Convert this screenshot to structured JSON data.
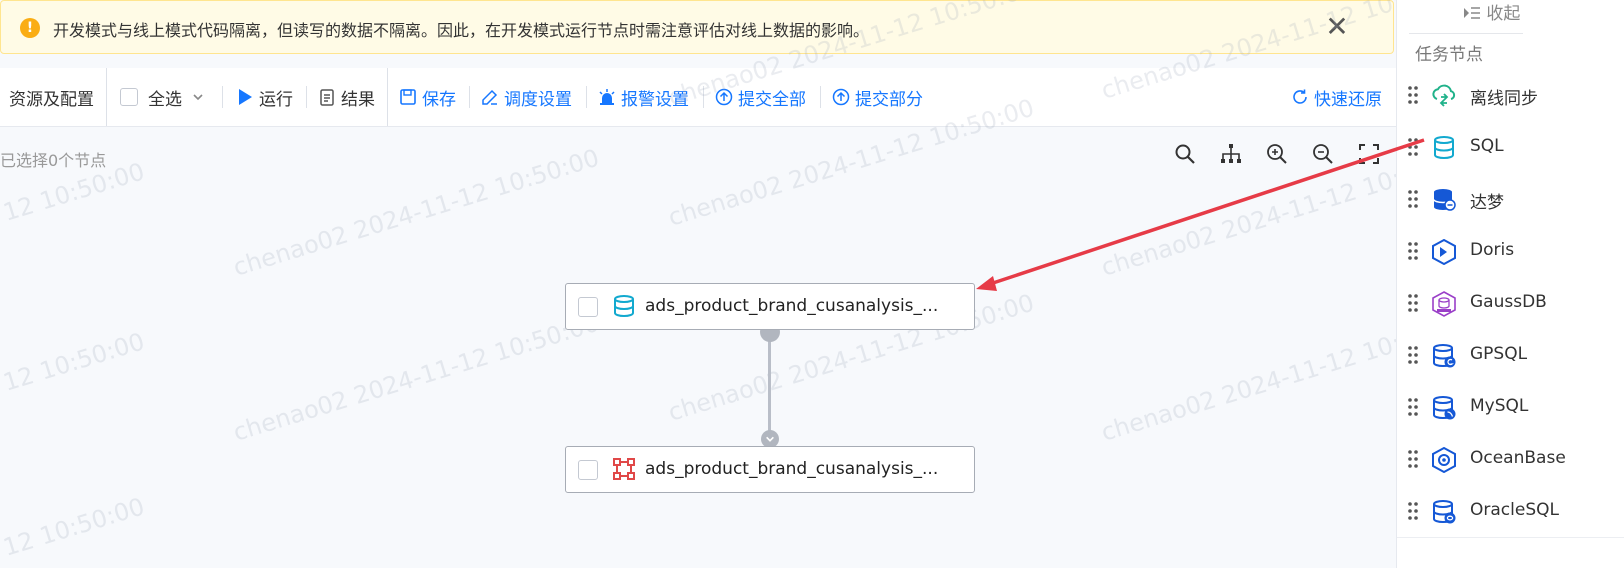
{
  "banner": {
    "text": "开发模式与线上模式代码隔离，但读写的数据不隔离。因此，在开发模式运行节点时需注意评估对线上数据的影响。",
    "icon": "warning-icon",
    "close_icon": "close-icon"
  },
  "toolbar": {
    "resources": "资源及配置",
    "select_all": "全选",
    "run": "运行",
    "result": "结果",
    "save": "保存",
    "schedule": "调度设置",
    "alarm": "报警设置",
    "submit_all": "提交全部",
    "submit_part": "提交部分",
    "quick_restore": "快速还原"
  },
  "canvas": {
    "selected_text": "已选择0个节点",
    "nodes": [
      {
        "label": "ads_product_brand_cusanalysis_...",
        "icon": "database-icon"
      },
      {
        "label": "ads_product_brand_cusanalysis_...",
        "icon": "node-frame-icon"
      }
    ]
  },
  "sidebar": {
    "collapse": "收起",
    "title": "任务节点",
    "items": [
      {
        "label": "离线同步",
        "icon": "cloud-sync-icon"
      },
      {
        "label": "SQL",
        "icon": "sql-db-icon"
      },
      {
        "label": "达梦",
        "icon": "dameng-db-icon"
      },
      {
        "label": "Doris",
        "icon": "doris-icon"
      },
      {
        "label": "GaussDB",
        "icon": "gaussdb-icon"
      },
      {
        "label": "GPSQL",
        "icon": "gpsql-icon"
      },
      {
        "label": "MySQL",
        "icon": "mysql-icon"
      },
      {
        "label": "OceanBase",
        "icon": "oceanbase-icon"
      },
      {
        "label": "OracleSQL",
        "icon": "oraclesql-icon"
      }
    ]
  },
  "watermark": {
    "text": "chenao02 2024-11-12 10:50:00",
    "partial": "12 10:50:00"
  },
  "colors": {
    "accent": "#1677ff",
    "warning": "#faad14",
    "arrow": "#e63b47"
  }
}
